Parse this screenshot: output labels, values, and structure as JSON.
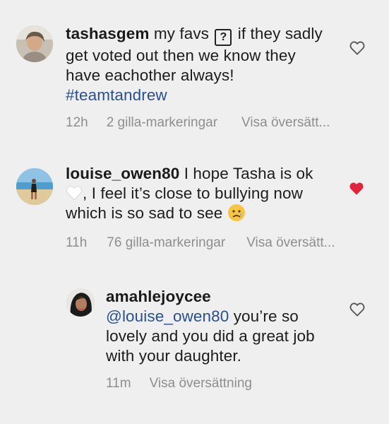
{
  "comments": [
    {
      "username": "tashasgem",
      "text_before": " my favs ",
      "text_after": " if they sadly get voted out then we know they have eachother always! ",
      "hashtag": "#teamtandrew",
      "box_glyph": "?",
      "time": "12h",
      "likes": "2 gilla-markeringar",
      "translate": "Visa översätt...",
      "liked": false
    },
    {
      "username": "louise_owen80",
      "text_before": " I hope Tasha is ok ",
      "text_after": ", I feel it’s close to bullying now which is so sad to see ",
      "time": "11h",
      "likes": "76 gilla-markeringar",
      "translate": "Visa översätt...",
      "liked": true
    },
    {
      "username": "amahlejoycee",
      "mention": "@louise_owen80",
      "text_after": " you’re so lovely and you did a great job with your daughter.",
      "time": "11m",
      "translate": "Visa översättning",
      "liked": false
    }
  ],
  "colors": {
    "background": "#efefef",
    "meta_text": "#8e8e8e",
    "link": "#2a4f8f",
    "like_active": "#e0243d"
  },
  "icons": {
    "like_empty": "heart-outline-icon",
    "like_filled": "heart-filled-icon",
    "white_heart_emoji": "white-heart-emoji",
    "crying_face_emoji": "crying-face-emoji",
    "question_box_emoji": "question-box-emoji"
  }
}
